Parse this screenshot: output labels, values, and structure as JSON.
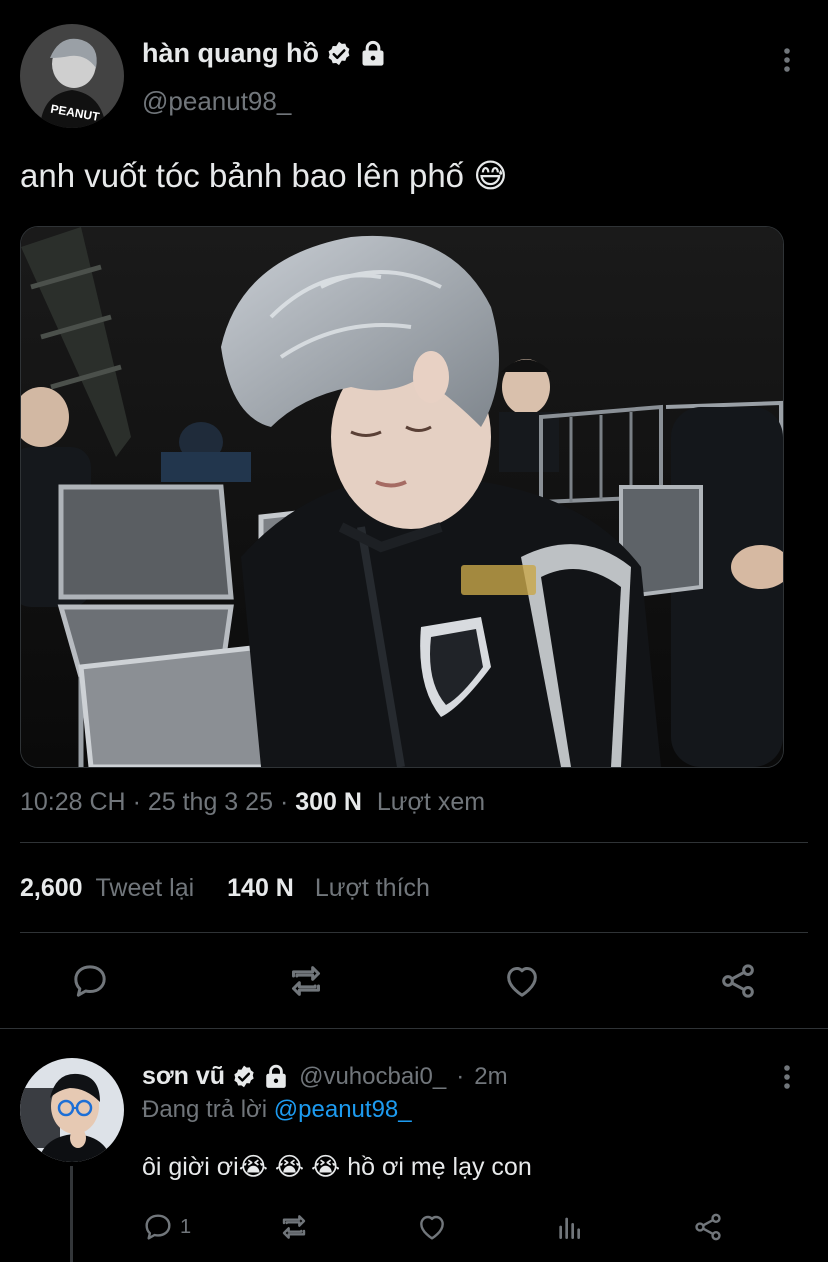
{
  "tweet": {
    "display_name": "hàn quang hồ",
    "handle": "@peanut98_",
    "avatar_icon": "avatar-peanut",
    "verified_icon": "verified-badge-icon",
    "lock_icon": "lock-icon",
    "text": "anh vuốt tóc bảnh bao lên phố",
    "emoji": "😅",
    "time": "10:28 CH",
    "separator": "·",
    "date": "25 thg 3 25",
    "views_count": "300 N",
    "views_label": "Lượt xem",
    "retweets_count": "2,600",
    "retweets_label": "Tweet lại",
    "likes_count": "140 N",
    "likes_label": "Lượt thích"
  },
  "actions": [
    "reply-icon",
    "retweet-icon",
    "like-icon",
    "share-icon"
  ],
  "reply": {
    "display_name": "sơn vũ",
    "handle": "@vuhocbai0_",
    "separator": "·",
    "age": "2m",
    "replying_to_prefix": "Đang trả lời",
    "replying_to": "@peanut98_",
    "text": "ôi giời ơi",
    "emojis": "😭 😭 😭",
    "text_tail": "hồ ơi mẹ lạy con",
    "reply_count": "1"
  },
  "colors": {
    "background": "#000000",
    "text": "#e7e9ea",
    "secondary": "#71767b",
    "link": "#1d9bf0",
    "divider": "#2f3336"
  }
}
